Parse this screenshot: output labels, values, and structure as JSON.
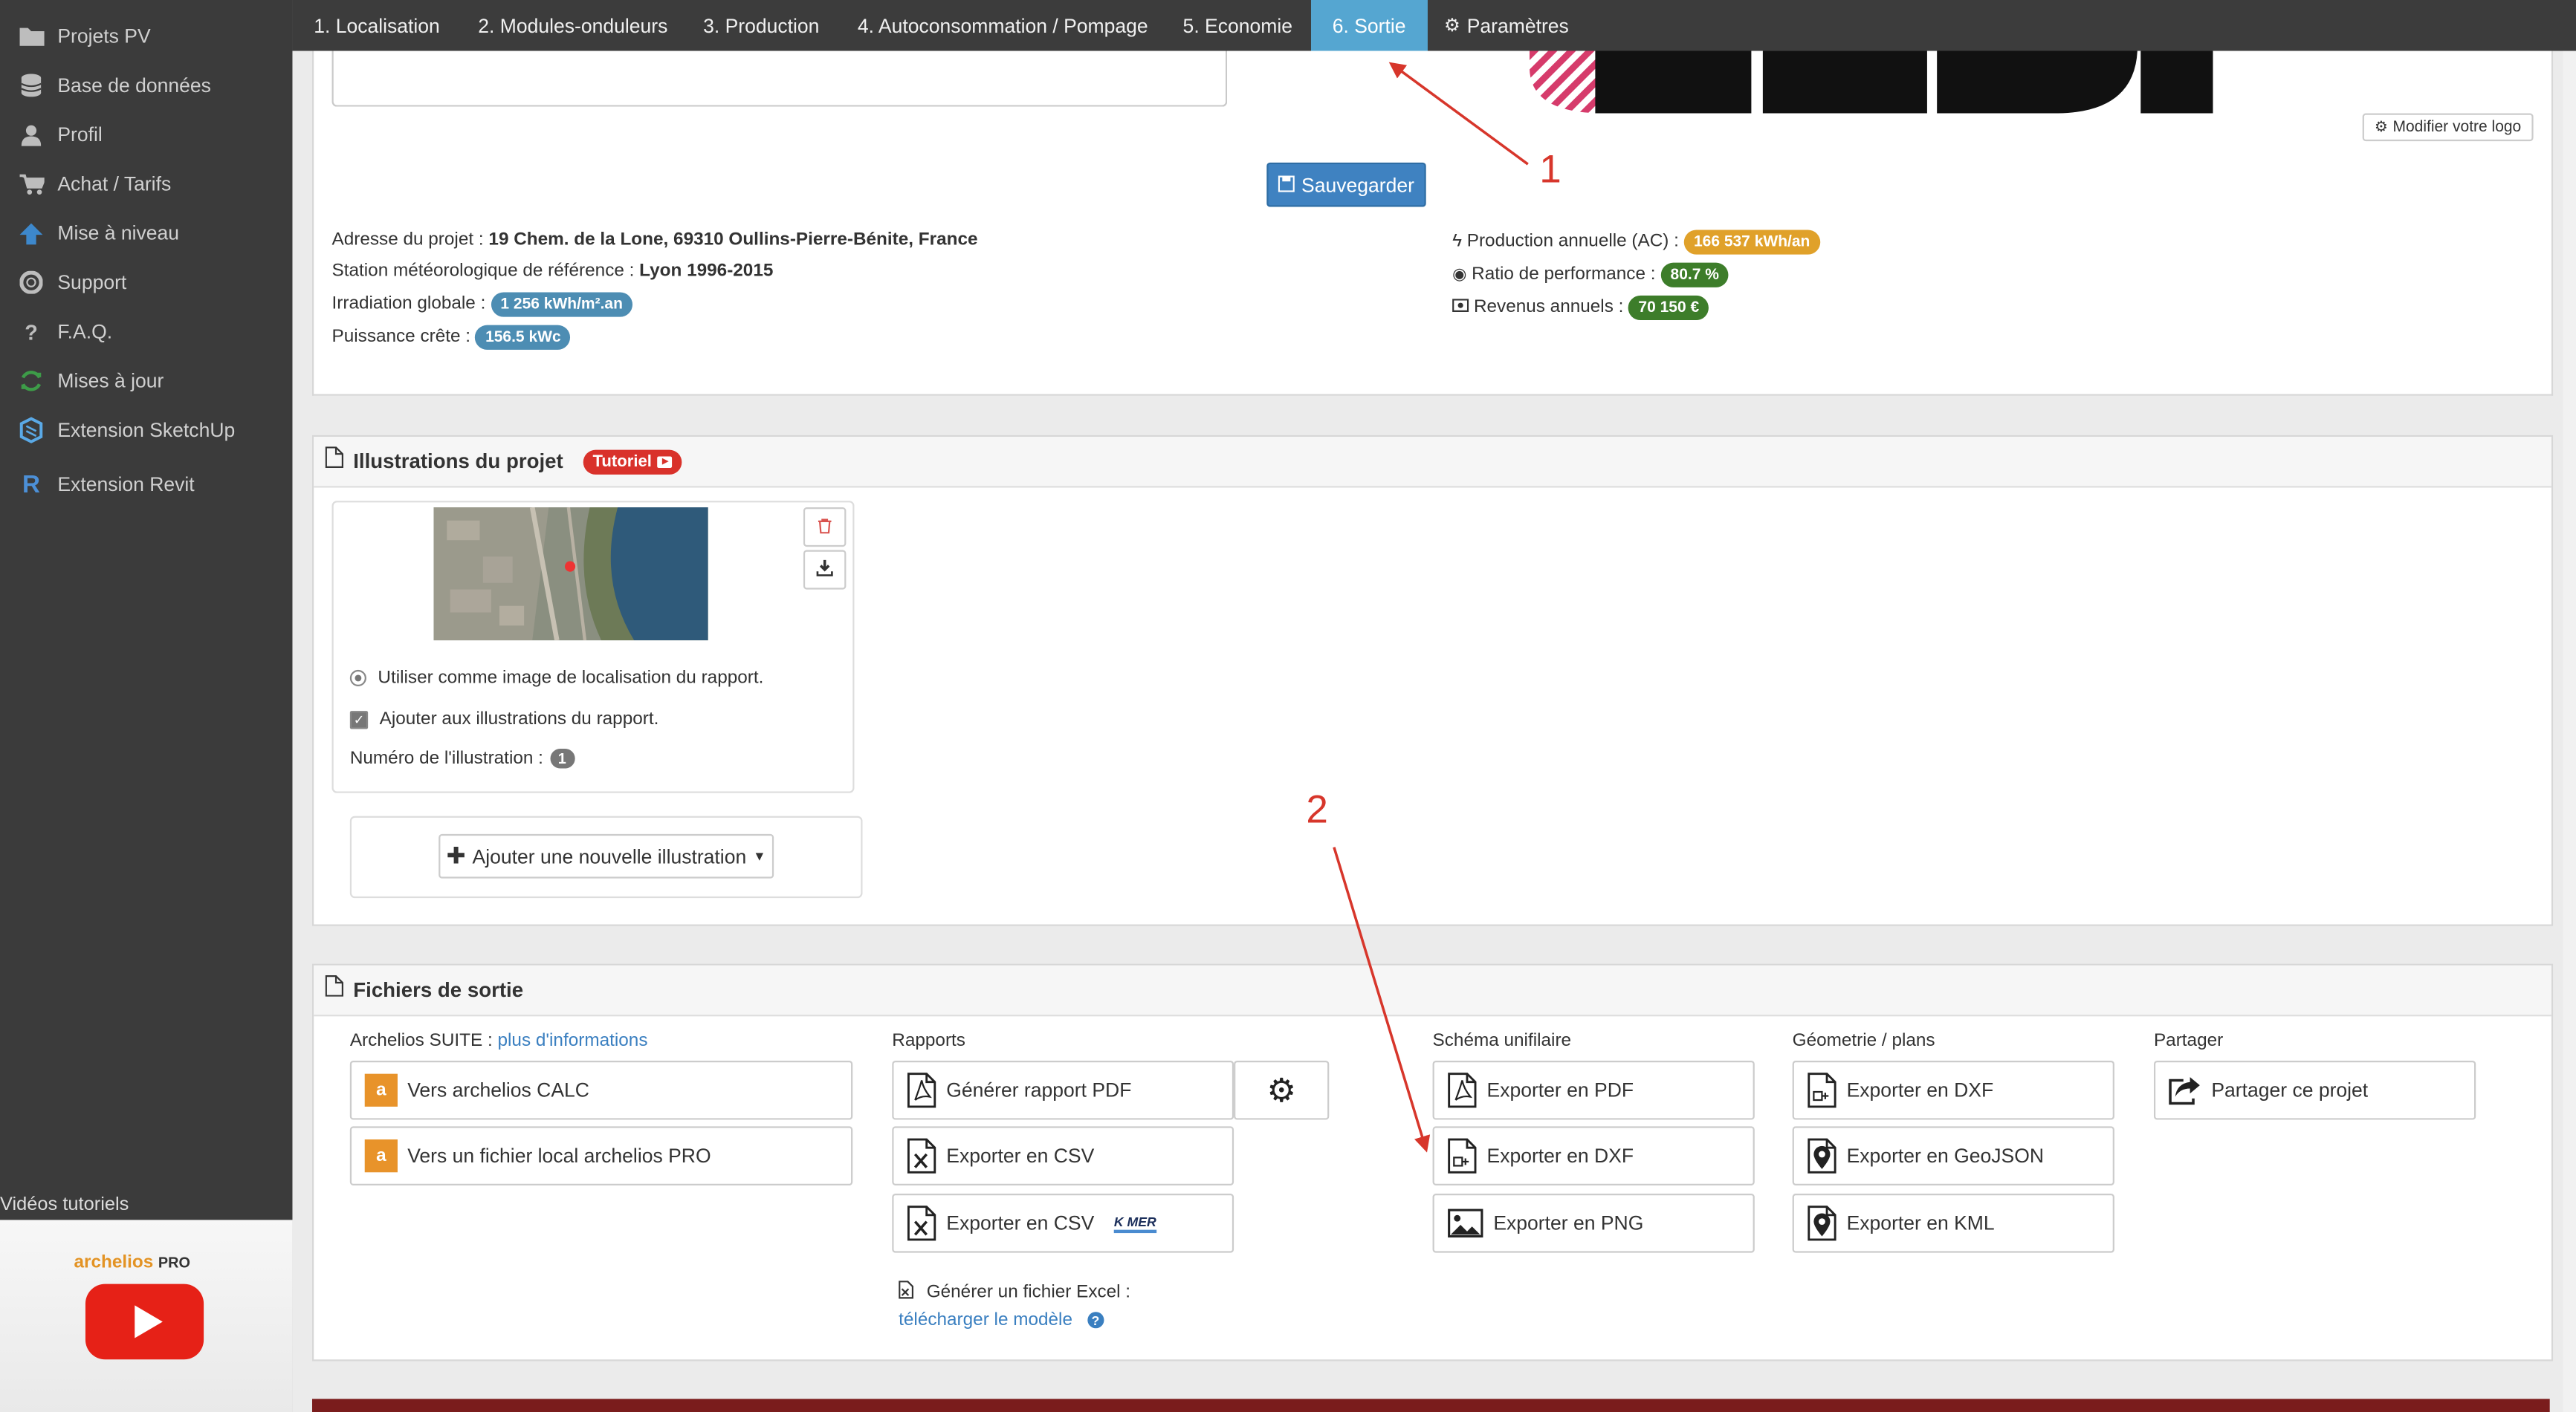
{
  "sidebar": {
    "items": [
      {
        "label": "Projets PV",
        "icon": "folder-icon"
      },
      {
        "label": "Base de données",
        "icon": "database-icon"
      },
      {
        "label": "Profil",
        "icon": "user-icon"
      },
      {
        "label": "Achat / Tarifs",
        "icon": "cart-icon"
      },
      {
        "label": "Mise à niveau",
        "icon": "arrow-up-icon"
      },
      {
        "label": "Support",
        "icon": "lifebuoy-icon"
      },
      {
        "label": "F.A.Q.",
        "icon": "question-icon"
      },
      {
        "label": "Mises à jour",
        "icon": "refresh-icon"
      },
      {
        "label": "Extension SketchUp",
        "icon": "sketchup-icon"
      },
      {
        "label": "Extension Revit",
        "icon": "revit-icon"
      }
    ],
    "videos_title": "Vidéos tutoriels",
    "video_brand": "archelios",
    "video_brand_suffix": "PRO"
  },
  "tabs": [
    {
      "label": "1. Localisation"
    },
    {
      "label": "2. Modules-onduleurs"
    },
    {
      "label": "3. Production"
    },
    {
      "label": "4. Autoconsommation / Pompage"
    },
    {
      "label": "5. Economie"
    },
    {
      "label": "6. Sortie",
      "active": true
    },
    {
      "label": "Paramètres",
      "icon": "gears-icon"
    }
  ],
  "top_panel": {
    "save_label": "Sauvegarder",
    "logo_button": "Modifier votre logo",
    "address_label": "Adresse du projet :",
    "address_value": "19 Chem. de la Lone, 69310 Oullins-Pierre-Bénite, France",
    "station_label": "Station météorologique de référence :",
    "station_value": "Lyon 1996-2015",
    "irradiation_label": "Irradiation globale :",
    "irradiation_value": "1 256 kWh/m².an",
    "power_label": "Puissance crête :",
    "power_value": "156.5 kWc",
    "production_label": "Production annuelle (AC) :",
    "production_value": "166 537 kWh/an",
    "ratio_label": "Ratio de performance :",
    "ratio_value": "80.7 %",
    "revenue_label": "Revenus annuels :",
    "revenue_value": "70 150 €"
  },
  "illustrations": {
    "title": "Illustrations du projet",
    "tutorial_badge": "Tutoriel",
    "radio_label": "Utiliser comme image de localisation du rapport.",
    "checkbox_label": "Ajouter aux illustrations du rapport.",
    "number_label": "Numéro de l'illustration :",
    "number_value": "1",
    "add_button": "Ajouter une nouvelle illustration"
  },
  "outputs": {
    "title": "Fichiers de sortie",
    "suite_title": "Archelios SUITE :",
    "suite_link": "plus d'informations",
    "suite_buttons": [
      "Vers archelios CALC",
      "Vers un fichier local archelios PRO"
    ],
    "reports_title": "Rapports",
    "report_buttons": [
      "Générer rapport PDF",
      "Exporter en CSV",
      "Exporter en CSV"
    ],
    "kmer_logo": "K MER",
    "excel_label": "Générer un fichier Excel :",
    "excel_link": "télécharger le modèle",
    "schema_title": "Schéma unifilaire",
    "schema_buttons": [
      "Exporter en PDF",
      "Exporter en DXF",
      "Exporter en PNG"
    ],
    "geometry_title": "Géometrie / plans",
    "geometry_buttons": [
      "Exporter en DXF",
      "Exporter en GeoJSON",
      "Exporter en KML"
    ],
    "share_title": "Partager",
    "share_button": "Partager ce projet"
  },
  "annotations": [
    "1",
    "2"
  ],
  "colors": {
    "active_tab": "#55a6d1",
    "save_button": "#3f82c1",
    "badge_blue": "#4d8db3",
    "badge_orange": "#e0a12a",
    "badge_green": "#3d7d2a",
    "annotation_red": "#d7362b",
    "tutorial_red": "#d9322b"
  }
}
